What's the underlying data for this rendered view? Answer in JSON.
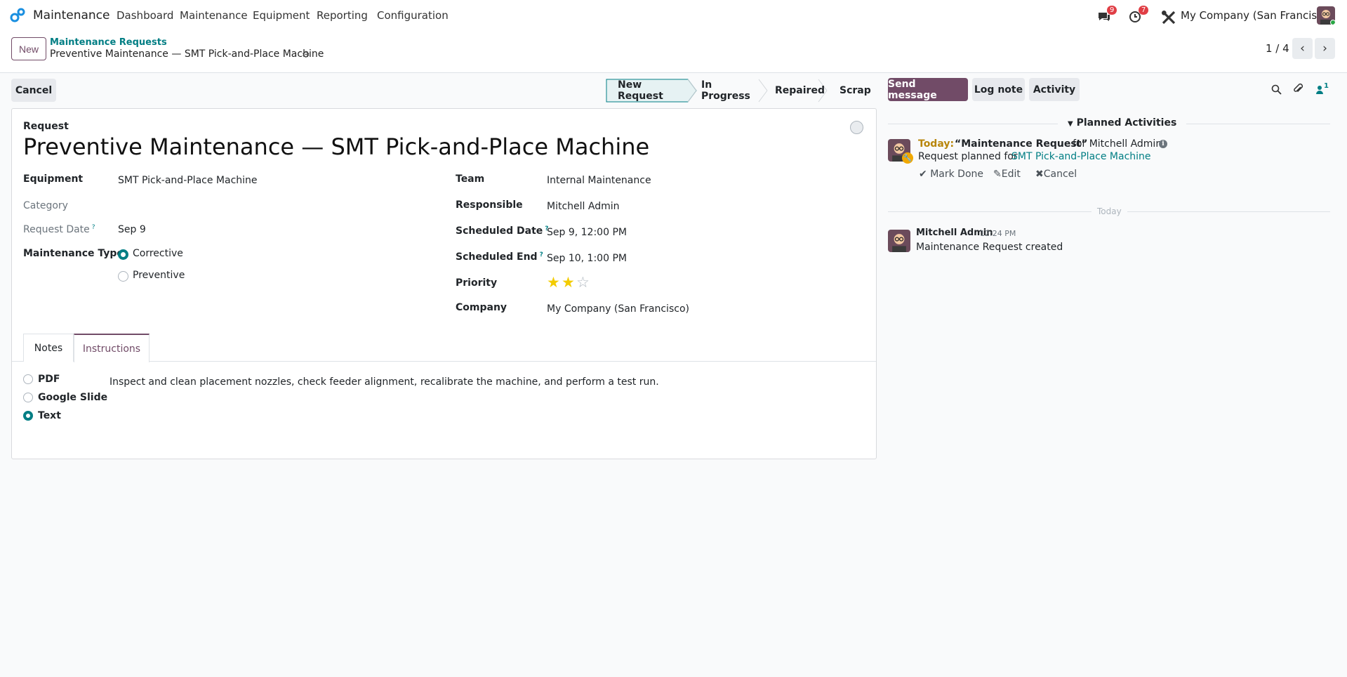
{
  "navbar": {
    "app_name": "Maintenance",
    "menu": [
      "Dashboard",
      "Maintenance",
      "Equipment",
      "Reporting",
      "Configuration"
    ],
    "messages_count": "9",
    "activities_count": "7",
    "company": "My Company (San Francisco)",
    "icons": {
      "app": "odoo-logo-icon",
      "messages": "chat-icon",
      "activities": "clock-icon",
      "debug": "tools-icon"
    }
  },
  "control_panel": {
    "new_label": "New",
    "breadcrumb_parent": "Maintenance Requests",
    "breadcrumb_current": "Preventive Maintenance — SMT Pick-and-Place Machine",
    "pager": "1 / 4"
  },
  "actions": {
    "cancel_label": "Cancel",
    "stages": [
      "New Request",
      "In Progress",
      "Repaired",
      "Scrap"
    ],
    "current_stage": "New Request"
  },
  "form": {
    "request_label": "Request",
    "title": "Preventive Maintenance — SMT Pick-and-Place Machine",
    "left": {
      "equipment_label": "Equipment",
      "equipment_value": "SMT Pick-and-Place Machine",
      "category_label": "Category",
      "category_value": "",
      "request_date_label": "Request Date",
      "request_date_value": "Sep 9",
      "maintenance_type_label": "Maintenance Type",
      "maintenance_type_options": [
        "Corrective",
        "Preventive"
      ],
      "maintenance_type_selected": "Corrective"
    },
    "right": {
      "team_label": "Team",
      "team_value": "Internal Maintenance",
      "responsible_label": "Responsible",
      "responsible_value": "Mitchell Admin",
      "scheduled_date_label": "Scheduled Date",
      "scheduled_date_value": "Sep 9, 12:00 PM",
      "scheduled_end_label": "Scheduled End",
      "scheduled_end_value": "Sep 10, 1:00 PM",
      "priority_label": "Priority",
      "priority_value": 2,
      "priority_max": 3,
      "company_label": "Company",
      "company_value": "My Company (San Francisco)"
    },
    "help_marker": "?",
    "tabs": [
      "Notes",
      "Instructions"
    ],
    "active_tab": "Instructions",
    "instruction_types": [
      "PDF",
      "Google Slide",
      "Text"
    ],
    "instruction_type_selected": "Text",
    "instructions_text": "Inspect and clean placement nozzles, check feeder alignment, recalibrate the machine, and perform a test run."
  },
  "chatter": {
    "send_message_label": "Send message",
    "log_note_label": "Log note",
    "activity_label": "Activity",
    "followers_count": "1",
    "planned_activities_label": "Planned Activities",
    "activity": {
      "when": "Today:",
      "name": "“Maintenance Request”",
      "for_text": "for Mitchell Admin",
      "summary_prefix": "Request planned for",
      "summary_link": "SMT Pick-and-Place Machine",
      "mark_done": "Mark Done",
      "edit": "Edit",
      "cancel": "Cancel"
    },
    "date_separator": "Today",
    "message": {
      "author": "Mitchell Admin",
      "time": "12:24 PM",
      "body": "Maintenance Request created"
    }
  },
  "colors": {
    "brand": "#714b67",
    "accent": "#017e84",
    "star": "#f3cc00",
    "badge": "#e03e45"
  }
}
